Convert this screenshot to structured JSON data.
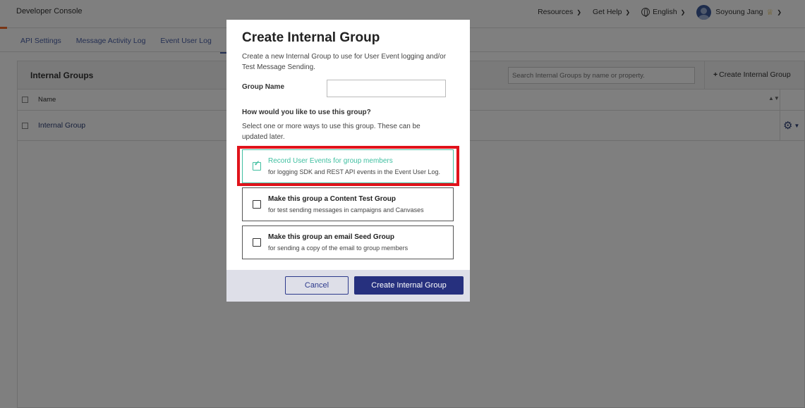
{
  "app": {
    "title": "Developer Console"
  },
  "top_nav": {
    "resources": "Resources",
    "get_help": "Get Help",
    "language": "English",
    "user_name": "Soyoung Jang"
  },
  "tabs": [
    {
      "label": "API Settings"
    },
    {
      "label": "Message Activity Log"
    },
    {
      "label": "Event User Log"
    },
    {
      "label": "In"
    }
  ],
  "panel": {
    "title": "Internal Groups",
    "search_placeholder": "Search Internal Groups by name or property.",
    "create_label": "Create Internal Group",
    "column_name": "Name",
    "rows": [
      {
        "name": "Internal Group"
      }
    ]
  },
  "modal": {
    "title": "Create Internal Group",
    "description": "Create a new Internal Group to use for User Event logging and/or Test Message Sending.",
    "group_name_label": "Group Name",
    "group_name_value": "",
    "question": "How would you like to use this group?",
    "helper": "Select one or more ways to use this group. These can be updated later.",
    "options": [
      {
        "title": "Record User Events for group members",
        "subtitle": "for logging SDK and REST API events in the Event User Log.",
        "checked": true
      },
      {
        "title": "Make this group a Content Test Group",
        "subtitle": "for test sending messages in campaigns and Canvases",
        "checked": false
      },
      {
        "title": "Make this group an email Seed Group",
        "subtitle": "for sending a copy of the email to group members",
        "checked": false
      }
    ],
    "cancel_label": "Cancel",
    "submit_label": "Create Internal Group"
  },
  "colors": {
    "accent": "#26307e",
    "checked": "#3fbfa0",
    "highlight": "#e0131b"
  }
}
